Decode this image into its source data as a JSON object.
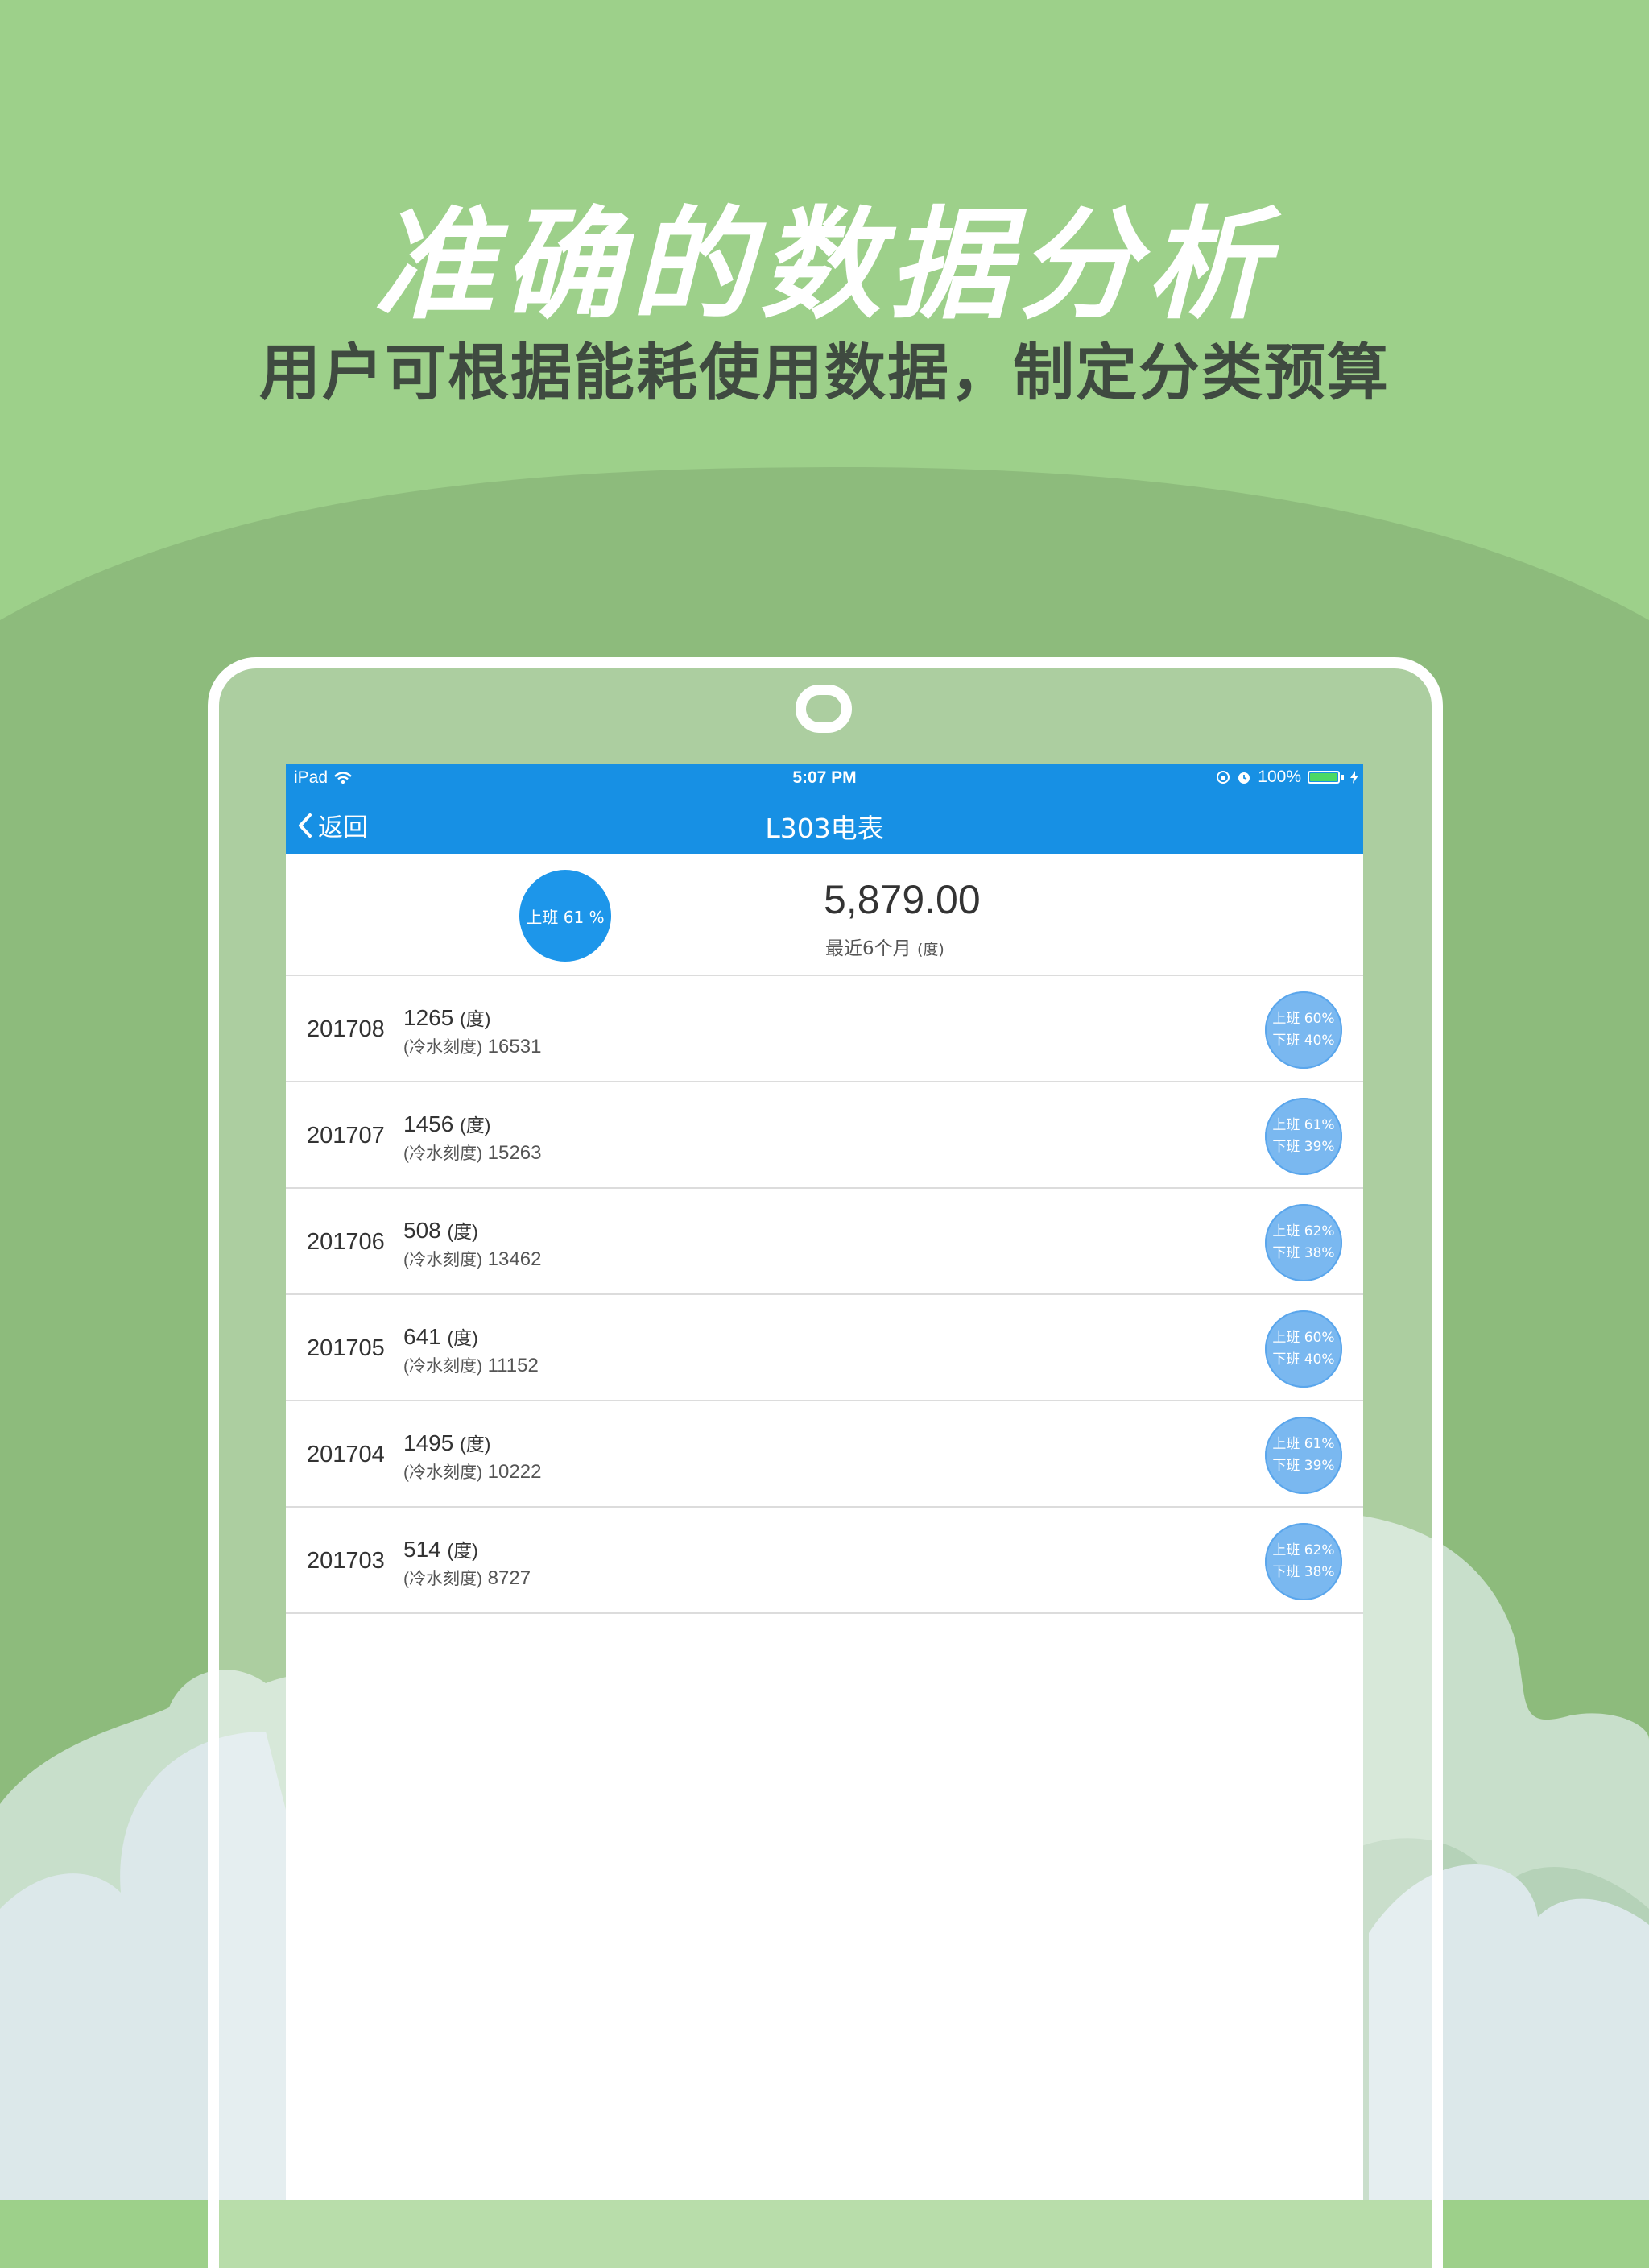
{
  "hero": {
    "title": "准确的数据分析",
    "subtitle": "用户可根据能耗使用数据，制定分类预算"
  },
  "status_bar": {
    "device": "iPad",
    "time": "5:07 PM",
    "battery": "100%",
    "battery_level": 1.0
  },
  "nav": {
    "back_label": "返回",
    "title": "L303电表"
  },
  "summary": {
    "pie_label": "上班 61 %",
    "total": "5,879.00",
    "caption": "最近6个月",
    "caption_unit": "(度)"
  },
  "records": [
    {
      "month": "201708",
      "usage": "1265",
      "unit": "(度)",
      "reading_label": "(冷水刻度)",
      "reading": "16531",
      "on_duty": "上班 60%",
      "off_duty": "下班 40%"
    },
    {
      "month": "201707",
      "usage": "1456",
      "unit": "(度)",
      "reading_label": "(冷水刻度)",
      "reading": "15263",
      "on_duty": "上班 61%",
      "off_duty": "下班 39%"
    },
    {
      "month": "201706",
      "usage": "508",
      "unit": "(度)",
      "reading_label": "(冷水刻度)",
      "reading": "13462",
      "on_duty": "上班 62%",
      "off_duty": "下班 38%"
    },
    {
      "month": "201705",
      "usage": "641",
      "unit": "(度)",
      "reading_label": "(冷水刻度)",
      "reading": "11152",
      "on_duty": "上班 60%",
      "off_duty": "下班 40%"
    },
    {
      "month": "201704",
      "usage": "1495",
      "unit": "(度)",
      "reading_label": "(冷水刻度)",
      "reading": "10222",
      "on_duty": "上班 61%",
      "off_duty": "下班 39%"
    },
    {
      "month": "201703",
      "usage": "514",
      "unit": "(度)",
      "reading_label": "(冷水刻度)",
      "reading": "8727",
      "on_duty": "上班 62%",
      "off_duty": "下班 38%"
    }
  ],
  "colors": {
    "background": "#9dd08a",
    "hill": "#8dbb7c",
    "accent_blue": "#1790e4",
    "pie_light": "#7ab8f0"
  }
}
